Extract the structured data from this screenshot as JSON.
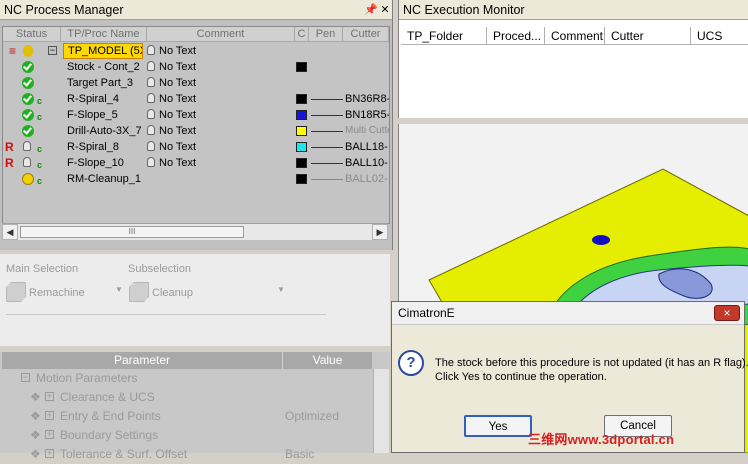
{
  "process_manager": {
    "title": "NC Process Manager",
    "pin_icon": "2",
    "close_icon": "×",
    "columns": [
      "Status",
      "TP/Proc Name",
      "Comment",
      "C",
      "Pen",
      "Cutter"
    ],
    "rows": [
      {
        "flag": "",
        "name": "TP_MODEL (5X)",
        "comment": "No Text",
        "swatch": "",
        "cutter": ""
      },
      {
        "flag": "",
        "name": "Stock - Cont_2",
        "comment": "No Text",
        "swatch": "#000000",
        "cutter": ""
      },
      {
        "flag": "",
        "name": "Target Part_3",
        "comment": "No Text",
        "swatch": "",
        "cutter": ""
      },
      {
        "flag": "c",
        "name": "R-Spiral_4",
        "comment": "No Text",
        "swatch": "#000000",
        "cutter": "BN36R8-"
      },
      {
        "flag": "c",
        "name": "F-Slope_5",
        "comment": "No Text",
        "swatch": "#1515d8",
        "cutter": "BN18R5-"
      },
      {
        "flag": "",
        "name": "Drill-Auto-3X_7",
        "comment": "No Text",
        "swatch": "#ffff00",
        "cutter": "Multi Cutte"
      },
      {
        "flag": "R",
        "name": "R-Spiral_8",
        "comment": "No Text",
        "swatch": "#22e4ef",
        "cutter": "BALL18-"
      },
      {
        "flag": "R",
        "name": "F-Slope_10",
        "comment": "No Text",
        "swatch": "#000000",
        "cutter": "BALL10-"
      },
      {
        "flag": "",
        "name": "RM-Cleanup_1",
        "comment": "",
        "swatch": "#000000",
        "cutter": "BALL02-"
      }
    ],
    "scroll_thumb": "III"
  },
  "selection": {
    "main_label": "Main Selection",
    "main_value": "Remachine",
    "sub_label": "Subselection",
    "sub_value": "Cleanup"
  },
  "parameters": {
    "col_parameter": "Parameter",
    "col_value": "Value",
    "rows": [
      {
        "label": "Motion Parameters",
        "value": ""
      },
      {
        "label": "Clearance & UCS",
        "value": ""
      },
      {
        "label": "Entry & End Points",
        "value": "Optimized"
      },
      {
        "label": "Boundary Settings",
        "value": ""
      },
      {
        "label": "Tolerance & Surf. Offset",
        "value": "Basic"
      }
    ]
  },
  "execution_monitor": {
    "title": "NC Execution Monitor",
    "columns": [
      "TP_Folder",
      "Proced...",
      "Comment",
      "Cutter",
      "UCS"
    ]
  },
  "dialog": {
    "title": "CimatronE",
    "message_line1": "The stock before this procedure is not updated (it has an R flag).",
    "message_line2": "Click Yes to continue the operation.",
    "yes_label": "Yes",
    "cancel_label": "Cancel",
    "close_label": "×",
    "question_icon": "?"
  },
  "watermark": "三维网www.3dportal.cn",
  "colors": {
    "status_green": "#22b022",
    "r_flag": "#d01010",
    "part_yellow": "#e5ee00",
    "part_green": "#3fd13f",
    "dialog_close": "#c0392b"
  }
}
